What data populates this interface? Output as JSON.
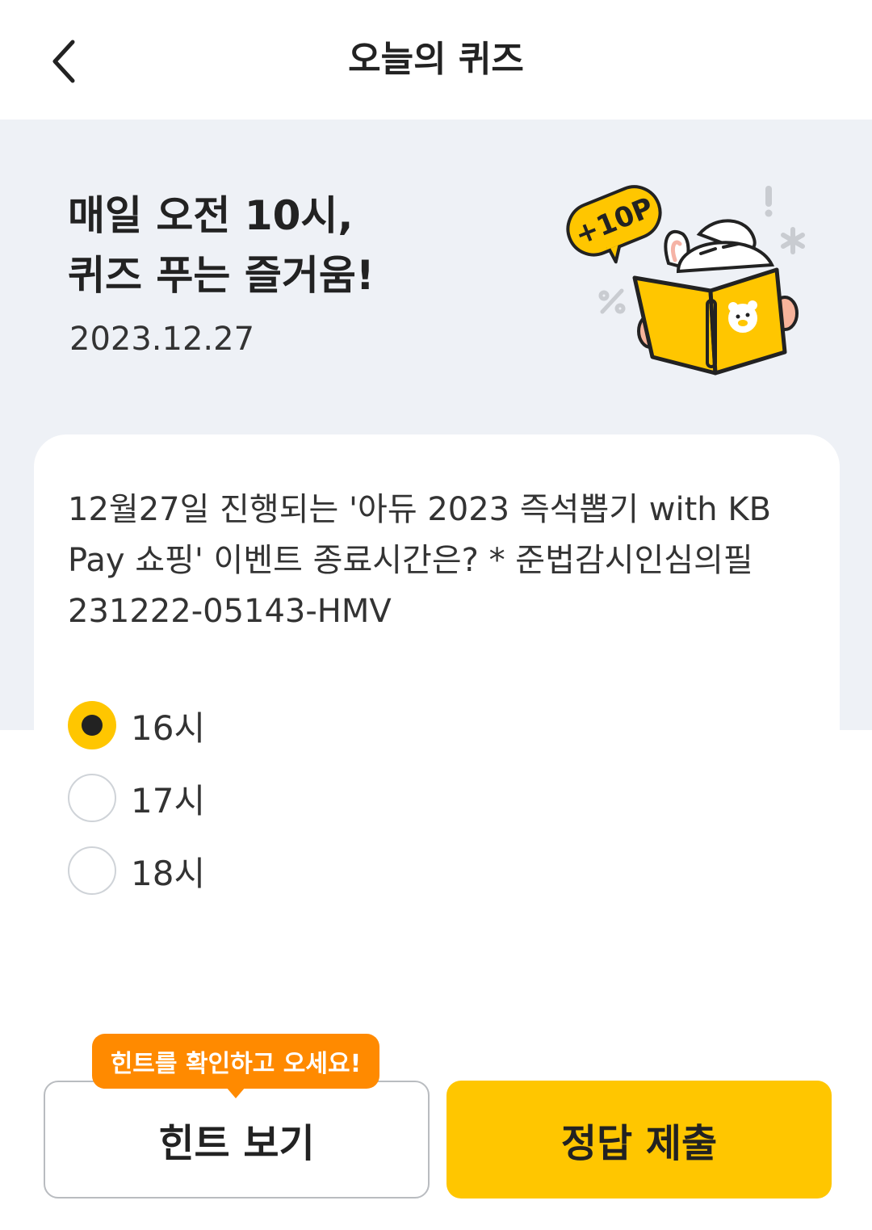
{
  "header": {
    "title": "오늘의 퀴즈",
    "back_icon": "chevron-left-icon"
  },
  "hero": {
    "headline_line1": "매일 오전 10시,",
    "headline_line2": "퀴즈 푸는 즐거움!",
    "date": "2023.12.27",
    "badge": "+10P"
  },
  "quiz": {
    "question": "12월27일 진행되는 '아듀 2023 즉석뽑기 with KB Pay 쇼핑' 이벤트 종료시간은? * 준법감시인심의필 231222-05143-HMV",
    "options": [
      {
        "label": "16시",
        "selected": true
      },
      {
        "label": "17시",
        "selected": false
      },
      {
        "label": "18시",
        "selected": false
      }
    ]
  },
  "actions": {
    "hint_tooltip": "힌트를 확인하고 오세요!",
    "hint_button": "힌트 보기",
    "submit_button": "정답 제출"
  },
  "colors": {
    "accent": "#ffc600",
    "tooltip": "#ff8a00",
    "hero_background": "#eef1f6"
  }
}
